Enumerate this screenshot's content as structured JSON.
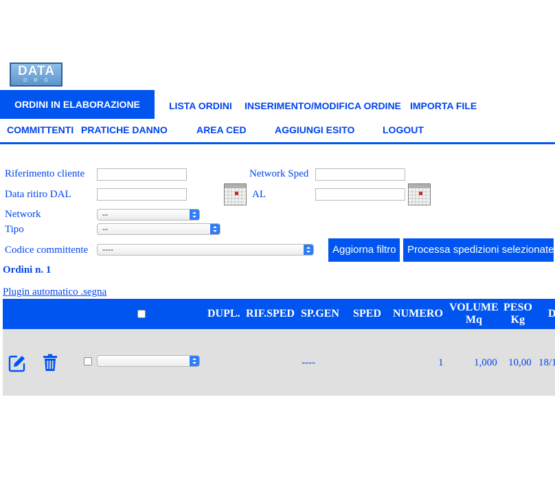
{
  "logo": {
    "main": "DATA",
    "sub": "ORG"
  },
  "nav": {
    "row1": [
      "ORDINI IN ELABORAZIONE",
      "LISTA ORDINI",
      "INSERIMENTO/MODIFICA ORDINE",
      "IMPORTA FILE"
    ],
    "row2": [
      "COMMITTENTI",
      "PRATICHE DANNO",
      "AREA CED",
      "AGGIUNGI ESITO",
      "LOGOUT"
    ],
    "active": "ORDINI IN ELABORAZIONE"
  },
  "filters": {
    "riferimento_cliente": {
      "label": "Riferimento cliente",
      "value": ""
    },
    "network_sped": {
      "label": "Network Sped",
      "value": ""
    },
    "data_ritiro_dal": {
      "label": "Data ritiro DAL",
      "value": ""
    },
    "al": {
      "label": "AL",
      "value": ""
    },
    "network": {
      "label": "Network",
      "value": "--"
    },
    "tipo": {
      "label": "Tipo",
      "value": "--"
    },
    "codice_committente": {
      "label": "Codice committente",
      "value": "----"
    }
  },
  "buttons": {
    "aggiorna": "Aggiorna filtro",
    "processa": "Processa spedizioni selezionate"
  },
  "ordini_count": "Ordini n. 1",
  "plugin_link": "Plugin automatico .segna",
  "table": {
    "headers": {
      "dupl": "DUPL.",
      "rif_sped": "RIF.SPED",
      "sp_gen": "SP.GEN",
      "sped": "SPED",
      "numero": "NUMERO",
      "volume": [
        "VOLUME",
        "Mq"
      ],
      "peso": [
        "PESO",
        "Kg"
      ],
      "next": "D"
    },
    "rows": [
      {
        "dupl_select": "",
        "sp_gen": "----",
        "numero": "1",
        "volume": "1,000",
        "peso": "10,00",
        "next": "18/1"
      }
    ]
  },
  "colors": {
    "primary": "#0055f0",
    "text": "#0044ee",
    "row_bg": "#e0e0e0"
  }
}
